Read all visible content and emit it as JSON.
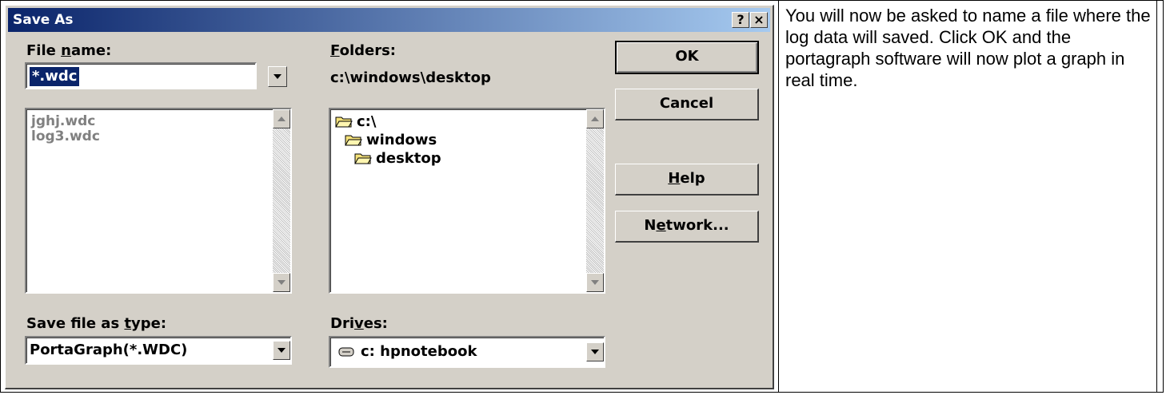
{
  "dialog": {
    "title": "Save As",
    "help_btn": "?",
    "close_btn": "×",
    "file_name": {
      "label_pre": "File ",
      "label_u": "n",
      "label_post": "ame:",
      "value": "*.wdc",
      "list": [
        "jghj.wdc",
        "log3.wdc"
      ]
    },
    "folders": {
      "label_u": "F",
      "label_post": "olders:",
      "path": "c:\\windows\\desktop",
      "tree": [
        "c:\\",
        "windows",
        "desktop"
      ]
    },
    "save_type": {
      "label_pre": "Save file as ",
      "label_u": "t",
      "label_post": "ype:",
      "value": "PortaGraph(*.WDC)"
    },
    "drives": {
      "label_pre": "Dri",
      "label_u": "v",
      "label_post": "es:",
      "value": "c: hpnotebook"
    },
    "buttons": {
      "ok": "OK",
      "cancel": "Cancel",
      "help_u": "H",
      "help_post": "elp",
      "network_pre": "N",
      "network_u": "e",
      "network_post": "twork..."
    }
  },
  "instruction_text": "You will now be asked to name a file where the log data will saved. Click OK and the portagraph software will now plot a graph in real time."
}
